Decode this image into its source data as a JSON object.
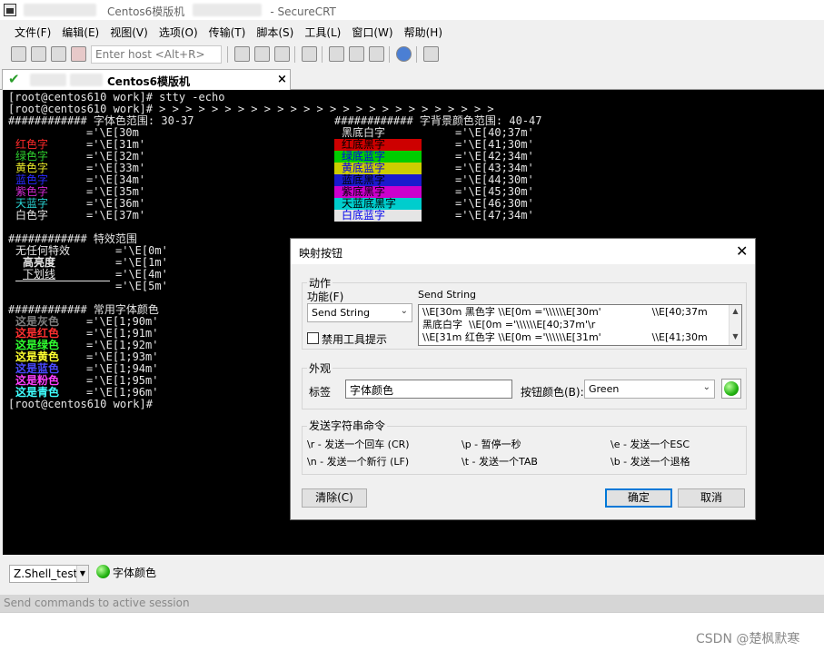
{
  "window": {
    "title": "Centos6模版机",
    "app": "- SecureCRT"
  },
  "menu": [
    "文件(F)",
    "编辑(E)",
    "视图(V)",
    "选项(O)",
    "传输(T)",
    "脚本(S)",
    "工具(L)",
    "窗口(W)",
    "帮助(H)"
  ],
  "toolbar": {
    "host_placeholder": "Enter host <Alt+R>"
  },
  "tab": {
    "title": "Centos6模版机",
    "close": "×"
  },
  "terminal": {
    "prompt_line": "[root@centos610 work]# stty -echo",
    "arrow_line": "[root@centos610 work]# > > > > > > > > > > > > > > > > > > > > > > > > > >",
    "fg_header": "############ 字体色范围: 30-37",
    "bg_header": "############ 字背景颜色范围: 40-47",
    "fg_first_code": "='\\E[30m",
    "fg_rows": [
      {
        "label": "红色字",
        "code": "='\\E[31m'",
        "color": "#ff2a2a"
      },
      {
        "label": "绿色字",
        "code": "='\\E[32m'",
        "color": "#2fd12f"
      },
      {
        "label": "黄色字",
        "code": "='\\E[33m'",
        "color": "#e8e82a"
      },
      {
        "label": "蓝色字",
        "code": "='\\E[34m'",
        "color": "#2a2aff"
      },
      {
        "label": "紫色字",
        "code": "='\\E[35m'",
        "color": "#d22ad2"
      },
      {
        "label": "天蓝字",
        "code": "='\\E[36m'",
        "color": "#2ad2d2"
      },
      {
        "label": "白色字",
        "code": "='\\E[37m'",
        "color": "#e6e6e6"
      }
    ],
    "bg_rows": [
      {
        "label": "黑底白字",
        "code": "='\\E[40;37m'",
        "bg": "#000000",
        "fg": "#e6e6e6"
      },
      {
        "label": "红底黑字",
        "code": "='\\E[41;30m'",
        "bg": "#cd0000",
        "fg": "#000000"
      },
      {
        "label": "绿底蓝字",
        "code": "='\\E[42;34m'",
        "bg": "#00cd00",
        "fg": "#0000ee"
      },
      {
        "label": "黄底蓝字",
        "code": "='\\E[43;34m'",
        "bg": "#cdcd00",
        "fg": "#0000ee"
      },
      {
        "label": "蓝底黑字",
        "code": "='\\E[44;30m'",
        "bg": "#1a1acd",
        "fg": "#000000"
      },
      {
        "label": "紫底黑字",
        "code": "='\\E[45;30m'",
        "bg": "#cd00cd",
        "fg": "#000000"
      },
      {
        "label": "天蓝底黑字",
        "code": "='\\E[46;30m'",
        "bg": "#00cdcd",
        "fg": "#000000"
      },
      {
        "label": "白底蓝字",
        "code": "='\\E[47;34m'",
        "bg": "#e5e5e5",
        "fg": "#0000ee"
      }
    ],
    "effect_header": "############ 特效范围",
    "effect_rows": [
      {
        "label": "无任何特效",
        "code": "='\\E[0m'"
      },
      {
        "label": "高亮度",
        "code": "='\\E[1m'"
      },
      {
        "label": "下划线",
        "code": "='\\E[4m'"
      },
      {
        "label": "",
        "code": "='\\E[5m'"
      }
    ],
    "common_header": "############ 常用字体颜色",
    "common_rows": [
      {
        "label": "这是灰色",
        "code": "='\\E[1;90m'",
        "color": "#7f7f7f"
      },
      {
        "label": "这是红色",
        "code": "='\\E[1;91m'",
        "color": "#ff3030"
      },
      {
        "label": "这是绿色",
        "code": "='\\E[1;92m'",
        "color": "#30ff30"
      },
      {
        "label": "这是黄色",
        "code": "='\\E[1;93m'",
        "color": "#ffff30"
      },
      {
        "label": "这是蓝色",
        "code": "='\\E[1;94m'",
        "color": "#4a4aff"
      },
      {
        "label": "这是粉色",
        "code": "='\\E[1;95m'",
        "color": "#ff40ff"
      },
      {
        "label": "这是青色",
        "code": "='\\E[1;96m'",
        "color": "#40ffff"
      }
    ],
    "last_prompt": "[root@centos610 work]#"
  },
  "dialog": {
    "title": "映射按钮",
    "close": "✕",
    "action_group": "动作",
    "function_label": "功能(F)",
    "function_value": "Send String",
    "send_string_label": "Send String",
    "send_string_lines": [
      "\\\\E[30m 黑色字 \\\\E[0m ='\\\\\\\\\\\\E[30m'                \\\\E[40;37m",
      "黑底白字  \\\\E[0m ='\\\\\\\\\\\\E[40;37m'\\r",
      "\\\\E[31m 红色字 \\\\E[0m ='\\\\\\\\\\\\E[31m'                \\\\E[41;30m"
    ],
    "disable_tooltip_label": "禁用工具提示",
    "appearance_group": "外观",
    "label_label": "标签",
    "label_value": "字体颜色",
    "button_color_label": "按钮颜色(B):",
    "button_color_value": "Green",
    "send_cmds_group": "发送字符串命令",
    "cmds": [
      "\\r - 发送一个回车 (CR)",
      "\\p - 暂停一秒",
      "\\e - 发送一个ESC",
      "\\n - 发送一个新行 (LF)",
      "\\t - 发送一个TAB",
      "\\b - 发送一个退格"
    ],
    "clear_button": "清除(C)",
    "ok_button": "确定",
    "cancel_button": "取消"
  },
  "session": {
    "combo_value": "Z.Shell_test",
    "button_label": "字体颜色",
    "send_placeholder": "Send commands to active session"
  },
  "watermark": "CSDN @楚枫默寒"
}
